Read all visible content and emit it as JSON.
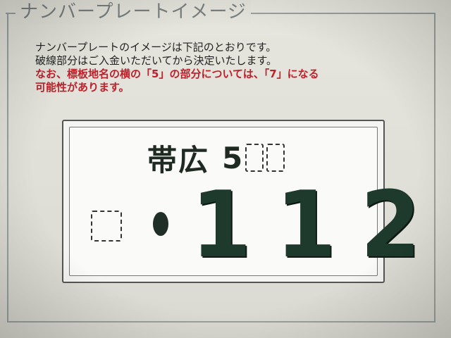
{
  "section": {
    "legend": "ナンバープレートイメージ"
  },
  "description": {
    "line1": "ナンバープレートのイメージは下記のとおりです。",
    "line2": "破線部分はご入金いただいてから決定いたします。",
    "note_line1": "なお、標板地名の横の「5」の部分については、「7」になる",
    "note_line2": "可能性があります。"
  },
  "plate": {
    "place_name": "帯広",
    "class_number": "5",
    "serial": "112"
  },
  "colors": {
    "note_text": "#c0202a",
    "plate_text": "#1d3a2c",
    "background": "#dcdcd4"
  }
}
